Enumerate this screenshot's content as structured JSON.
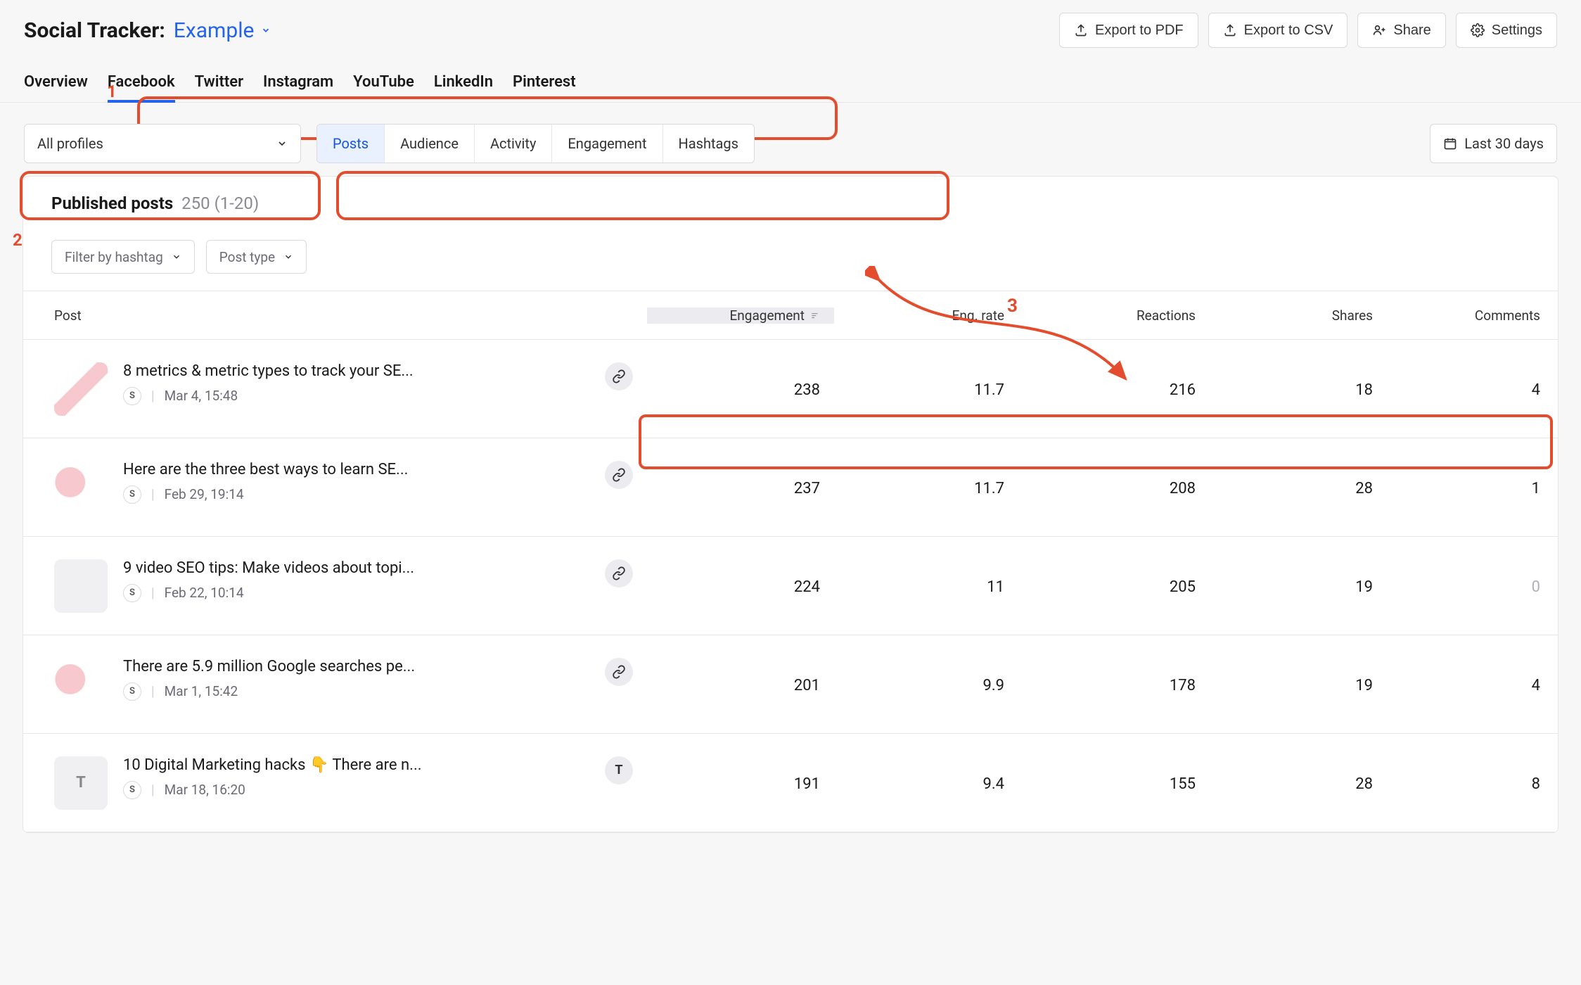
{
  "header": {
    "title": "Social Tracker:",
    "project": "Example",
    "actions": {
      "export_pdf": "Export to PDF",
      "export_csv": "Export to CSV",
      "share": "Share",
      "settings": "Settings"
    }
  },
  "main_tabs": [
    "Overview",
    "Facebook",
    "Twitter",
    "Instagram",
    "YouTube",
    "LinkedIn",
    "Pinterest"
  ],
  "main_tab_active": "Facebook",
  "profiles_select": "All profiles",
  "sub_tabs": [
    "Posts",
    "Audience",
    "Activity",
    "Engagement",
    "Hashtags"
  ],
  "sub_tab_active": "Posts",
  "date_range": "Last 30 days",
  "card": {
    "title": "Published posts",
    "count_range": "250 (1-20)",
    "filters": {
      "hashtag": "Filter by hashtag",
      "post_type": "Post type"
    }
  },
  "columns": [
    "Post",
    "Engagement",
    "Eng. rate",
    "Reactions",
    "Shares",
    "Comments"
  ],
  "sort_column": "Engagement",
  "rows": [
    {
      "title": "8 metrics & metric types to track your SE...",
      "date": "Mar 4, 15:48",
      "badge": "S",
      "kind": "link",
      "engagement": 238,
      "eng_rate": "11.7",
      "reactions": 216,
      "shares": 18,
      "comments": 4,
      "thumb": "t1"
    },
    {
      "title": "Here are the three best ways to learn SE...",
      "date": "Feb 29, 19:14",
      "badge": "S",
      "kind": "link",
      "engagement": 237,
      "eng_rate": "11.7",
      "reactions": 208,
      "shares": 28,
      "comments": 1,
      "thumb": "t-pink"
    },
    {
      "title": "9 video SEO tips: Make videos about topi...",
      "date": "Feb 22, 10:14",
      "badge": "S",
      "kind": "link",
      "engagement": 224,
      "eng_rate": "11",
      "reactions": 205,
      "shares": 19,
      "comments": 0,
      "thumb": "blank"
    },
    {
      "title": "There are 5.9 million Google searches pe...",
      "date": "Mar 1, 15:42",
      "badge": "S",
      "kind": "link",
      "engagement": 201,
      "eng_rate": "9.9",
      "reactions": 178,
      "shares": 19,
      "comments": 4,
      "thumb": "t-pink"
    },
    {
      "title": "10 Digital Marketing hacks 👇 There are n...",
      "date": "Mar 18, 16:20",
      "badge": "S",
      "kind": "text",
      "engagement": 191,
      "eng_rate": "9.4",
      "reactions": 155,
      "shares": 28,
      "comments": 8,
      "thumb": "text"
    }
  ],
  "annotations": {
    "one": "1",
    "two": "2",
    "three": "3"
  }
}
